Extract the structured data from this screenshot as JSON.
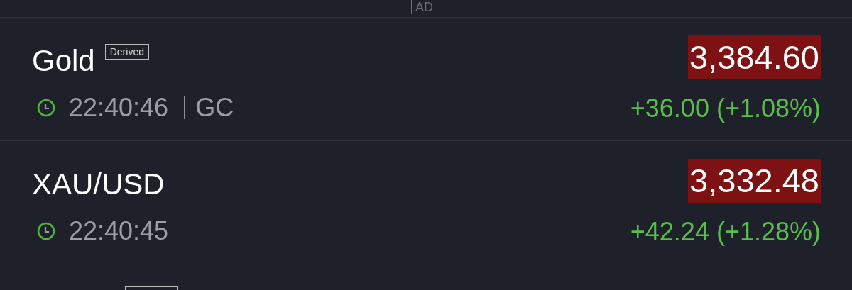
{
  "ad_label": "AD",
  "quotes": [
    {
      "name": "Gold",
      "badge": "Derived",
      "time": "22:40:46",
      "symbol": "GC",
      "price": "3,384.60",
      "flashed_down": true,
      "change": "+36.00 (+1.08%)",
      "rising": true
    },
    {
      "name": "XAU/USD",
      "time": "22:40:45",
      "price": "3,332.48",
      "flashed_down": true,
      "change": "+42.24 (+1.28%)",
      "rising": true
    }
  ],
  "next_row": {
    "badge_outline": true
  }
}
